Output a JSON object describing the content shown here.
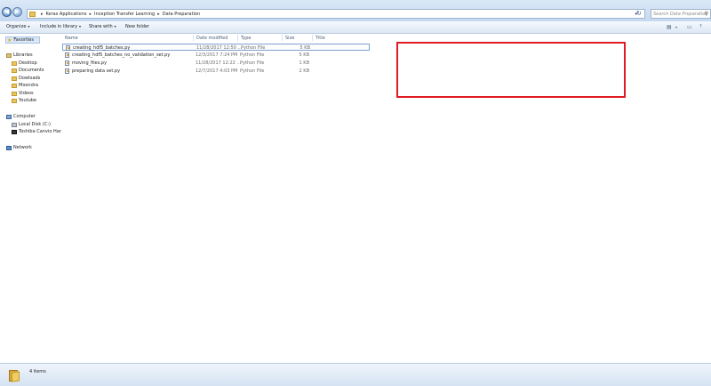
{
  "address_bar": {
    "breadcrumbs": [
      "Keras Applications",
      "Inception Transfer Learning",
      "Data Preparation"
    ],
    "search_placeholder": "Search Data Preparation"
  },
  "toolbar": {
    "organize": "Organize",
    "include_in_library": "Include in library",
    "share_with": "Share with",
    "new_folder": "New folder"
  },
  "nav_pane": {
    "favorites": "Favorites",
    "libraries": "Libraries",
    "library_items": [
      "Desktop",
      "Documents",
      "Dowloads",
      "Moondra",
      "Videos",
      "Youtube"
    ],
    "computer": "Computer",
    "computer_items": [
      "Local Disk (C:)",
      "Toshiba Canvio Har"
    ],
    "network": "Network"
  },
  "columns": {
    "name": "Name",
    "date_modified": "Date modified",
    "type": "Type",
    "size": "Size",
    "title": "Title"
  },
  "files": [
    {
      "name": "creating_hdf5_batches.py",
      "date": "11/28/2017 12:50 ...",
      "type": "Python File",
      "size": "5 KB"
    },
    {
      "name": "creating_hdf5_batches_no_validation_set.py",
      "date": "12/3/2017 7:24 PM",
      "type": "Python File",
      "size": "5 KB"
    },
    {
      "name": "moving_files.py",
      "date": "11/28/2017 12:22 ...",
      "type": "Python File",
      "size": "1 KB"
    },
    {
      "name": "preparing data set.py",
      "date": "12/7/2017 4:03 PM",
      "type": "Python File",
      "size": "2 KB"
    }
  ],
  "status": {
    "item_count": "4 items"
  },
  "colors": {
    "annotation_box": "#e01b24",
    "chrome_blue": "#c6d9f0"
  }
}
